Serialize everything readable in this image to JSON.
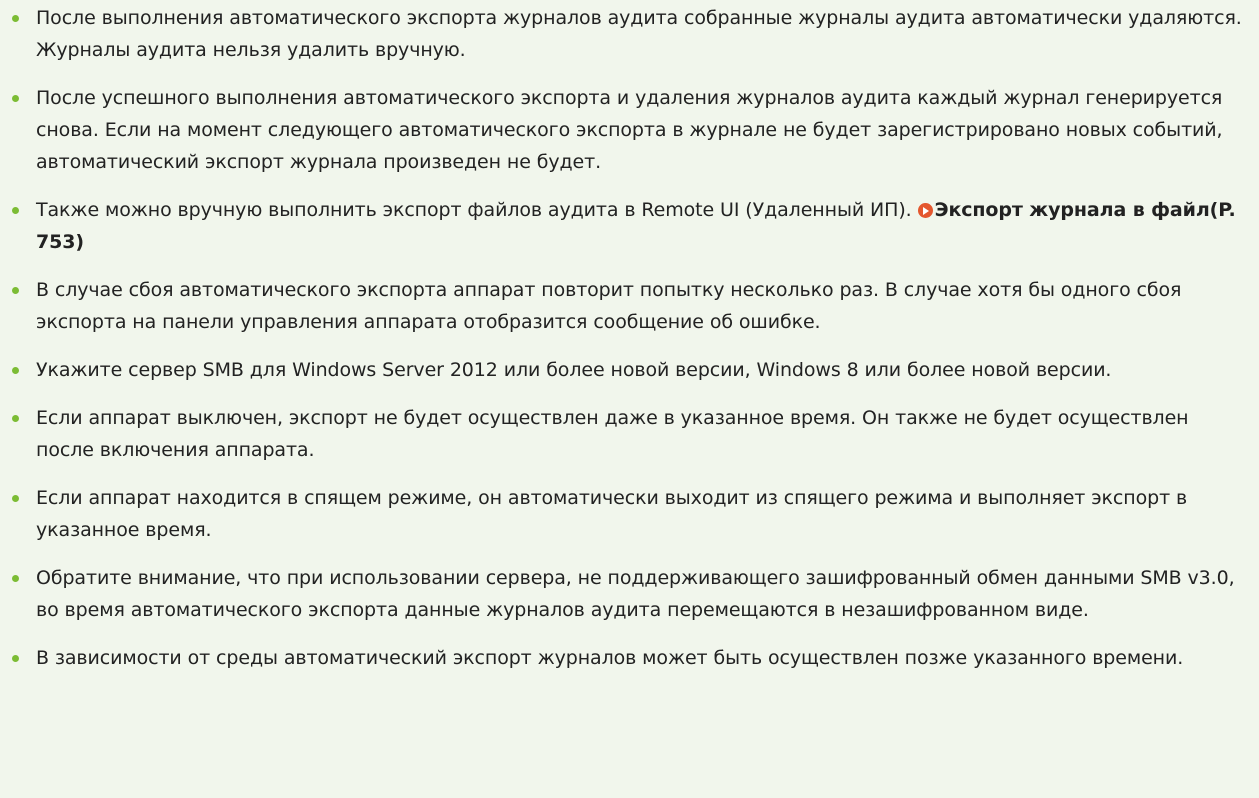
{
  "notes": [
    {
      "text": "После выполнения автоматического экспорта журналов аудита собранные журналы аудита автоматически удаляются. Журналы аудита нельзя удалить вручную."
    },
    {
      "text": "После успешного выполнения автоматического экспорта и удаления журналов аудита каждый журнал генерируется снова. Если на момент следующего автоматического экспорта в журнале не будет зарегистрировано новых событий, автоматический экспорт журнала произведен не будет."
    },
    {
      "text": "Также можно вручную выполнить экспорт файлов аудита в Remote UI (Удаленный ИП).",
      "link": "Экспорт журнала в файл(P. 753)"
    },
    {
      "text": "В случае сбоя автоматического экспорта аппарат повторит попытку несколько раз. В случае хотя бы одного сбоя экспорта на панели управления аппарата отобразится сообщение об ошибке."
    },
    {
      "text": "Укажите сервер SMB для Windows Server 2012 или более новой версии, Windows 8 или более новой версии."
    },
    {
      "text": "Если аппарат выключен, экспорт не будет осуществлен даже в указанное время. Он также не будет осуществлен после включения аппарата."
    },
    {
      "text": "Если аппарат находится в спящем режиме, он автоматически выходит из спящего режима и выполняет экспорт в указанное время."
    },
    {
      "text": "Обратите внимание, что при использовании сервера, не поддерживающего зашифрованный обмен данными SMB v3.0, во время автоматического экспорта данные журналов аудита перемещаются в незашифрованном виде."
    },
    {
      "text": "В зависимости от среды автоматический экспорт журналов может быть осуществлен позже указанного времени."
    }
  ],
  "colors": {
    "background": "#f1f6ec",
    "bullet": "#7cbc34",
    "link_icon": "#e4572e",
    "text": "#222222"
  },
  "icons": {
    "bullet": "green-dot-bullet-icon",
    "link": "arrow-circle-link-icon"
  }
}
